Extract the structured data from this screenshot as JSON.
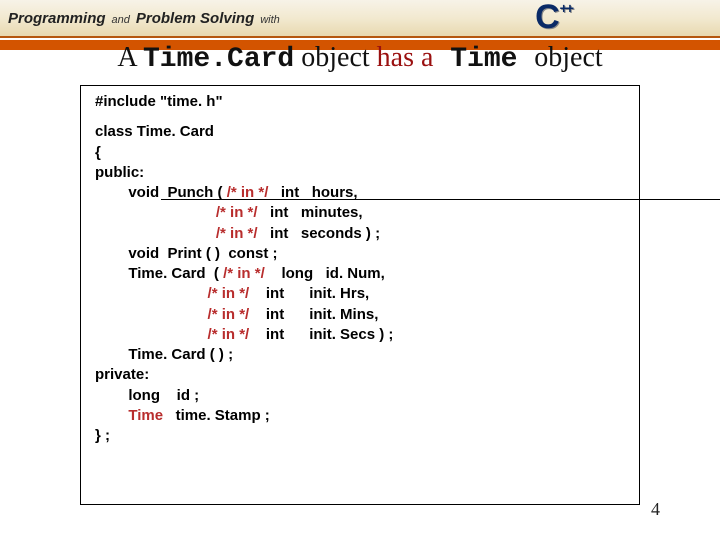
{
  "brand": {
    "programming": "Programming",
    "and": "and",
    "problem": "Problem Solving",
    "with": "with",
    "cpp": "C",
    "pp": "++"
  },
  "title": {
    "a": "A ",
    "timecard": "Time.Card",
    "obj1": " object ",
    "hasa": "has a",
    "time": " Time ",
    "obj2": "object"
  },
  "code": {
    "include": "#include  \"time. h\"",
    "l1": "class Time. Card",
    "l2": "{",
    "l3": "public:",
    "l4_a": "        void  Punch ( ",
    "l4_c": "/* in */",
    "l4_b": "   int   hours,",
    "l5_a": "                             ",
    "l5_c": "/* in */",
    "l5_b": "   int   minutes,",
    "l6_a": "                             ",
    "l6_c": "/* in */",
    "l6_b": "   int   seconds ) ;",
    "l7": "        void  Print ( )  const ;",
    "l8_a": "        Time. Card  ( ",
    "l8_c": "/* in */",
    "l8_b": "    long   id. Num,",
    "l9_a": "                           ",
    "l9_c": "/* in */",
    "l9_b": "    int      init. Hrs,",
    "l10_a": "                           ",
    "l10_c": "/* in */",
    "l10_b": "    int      init. Mins,",
    "l11_a": "                           ",
    "l11_c": "/* in */",
    "l11_b": "    int      init. Secs ) ;",
    "l12": "        Time. Card ( ) ;",
    "l13": "private:",
    "l14": "        long    id ;",
    "l15_a": "        ",
    "l15_t": "Time",
    "l15_b": "   time. Stamp ;",
    "l16": "} ;"
  },
  "page": "4"
}
